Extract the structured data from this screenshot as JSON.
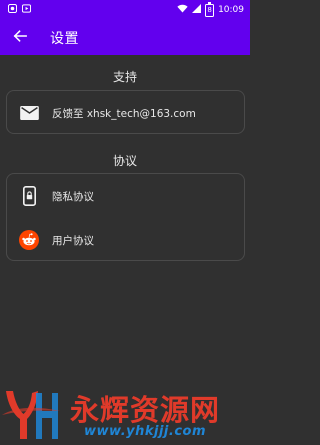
{
  "status_bar": {
    "time": "10:09",
    "battery": "8",
    "left_icons": [
      "app-icon",
      "play-icon"
    ],
    "right_icons": [
      "wifi-icon",
      "signal-icon",
      "battery-icon"
    ]
  },
  "app_bar": {
    "back_icon": "arrow-left-icon",
    "title": "设置"
  },
  "sections": {
    "support": {
      "title": "支持",
      "feedback_label": "反馈至 xhsk_tech@163.com",
      "feedback_icon": "mail-icon"
    },
    "agreement": {
      "title": "协议",
      "privacy_label": "隐私协议",
      "privacy_icon": "phone-lock-icon",
      "user_label": "用户协议",
      "user_icon": "reddit-icon"
    }
  },
  "watermark": {
    "name": "永辉资源网",
    "url": "www.yhkjjj.com",
    "logo_colors": [
      "#e03a2a",
      "#1f86d6"
    ]
  },
  "colors": {
    "primary": "#6200ee",
    "background": "#303030",
    "card_border": "#4a4a4a",
    "reddit_orange": "#ff4500"
  }
}
